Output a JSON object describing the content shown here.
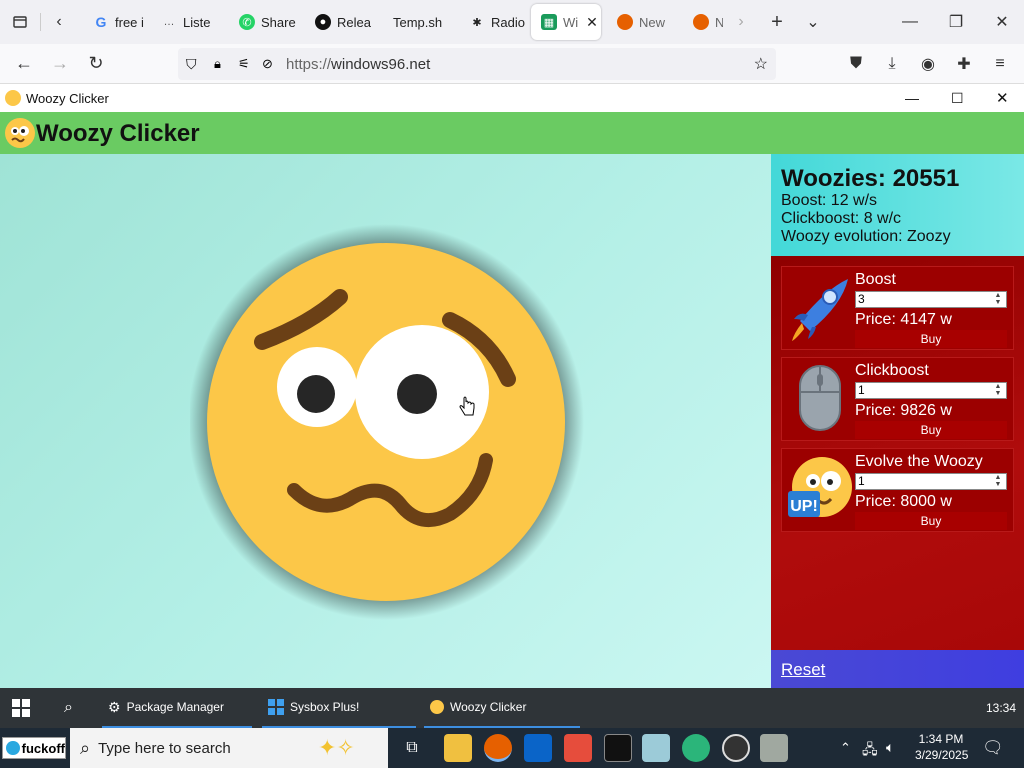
{
  "browser": {
    "tabs": [
      {
        "label": "free i",
        "icon": "google-icon"
      },
      {
        "label": "Liste",
        "icon": "dots-icon"
      },
      {
        "label": "Share",
        "icon": "whatsapp-icon"
      },
      {
        "label": "Relea",
        "icon": "github-icon"
      },
      {
        "label": "Temp.sh",
        "icon": "none"
      },
      {
        "label": "Radio",
        "icon": "radio-icon"
      },
      {
        "label": "Wi",
        "icon": "windows96-icon",
        "active": true
      },
      {
        "label": "New",
        "icon": "firefox-icon"
      },
      {
        "label": "N",
        "icon": "firefox-icon"
      }
    ],
    "url_scheme": "https://",
    "url_host": "windows96.net"
  },
  "window": {
    "title": "Woozy Clicker"
  },
  "app": {
    "title": "Woozy Clicker",
    "woozies_label": "Woozies: 20551",
    "boost_line": "Boost: 12 w/s",
    "clickboost_line": "Clickboost: 8 w/c",
    "evolution_line": "Woozy evolution: Zoozy",
    "shop": [
      {
        "name": "Boost",
        "qty": "3",
        "price": "Price: 4147 w",
        "buy": "Buy",
        "icon": "rocket-icon"
      },
      {
        "name": "Clickboost",
        "qty": "1",
        "price": "Price: 9826 w",
        "buy": "Buy",
        "icon": "mouse-icon"
      },
      {
        "name": "Evolve the Woozy",
        "qty": "1",
        "price": "Price: 8000 w",
        "buy": "Buy",
        "icon": "woozy-up-icon",
        "badge": "UP!"
      }
    ],
    "reset_label": "Reset"
  },
  "w96_taskbar": {
    "tasks": [
      "Package Manager",
      "Sysbox Plus!",
      "Woozy Clicker"
    ],
    "clock": "13:34"
  },
  "win_taskbar": {
    "start_label": "fuckoff",
    "search_placeholder": "Type here to search",
    "time": "1:34 PM",
    "date": "3/29/2025"
  },
  "colors": {
    "header_green": "#6acb62",
    "shop_red": "#9c0000",
    "stats_cyan": "#43d8d8",
    "reset_blue": "#4a49d4",
    "woozy_yellow": "#fcc748"
  }
}
